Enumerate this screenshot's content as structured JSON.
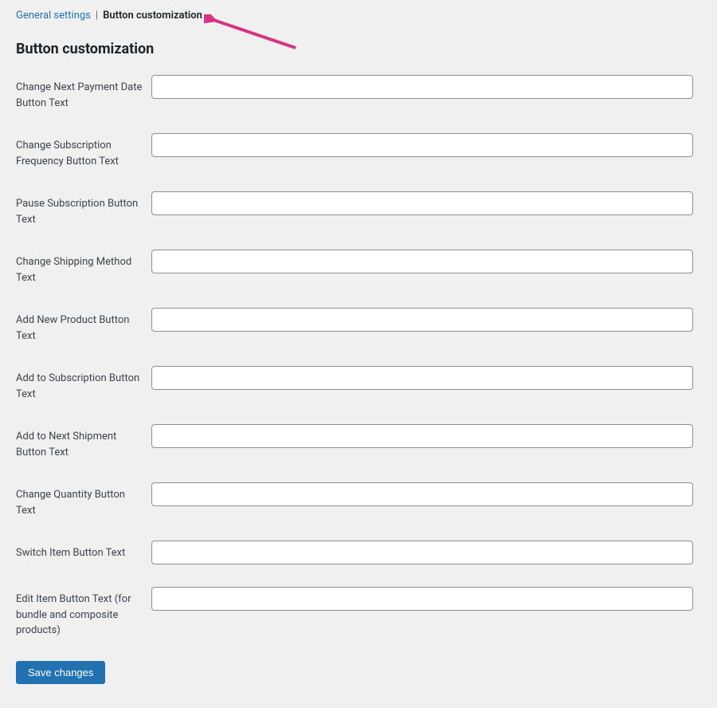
{
  "tabs": {
    "general": "General settings",
    "button_custom": "Button customization"
  },
  "section_title": "Button customization",
  "fields": [
    {
      "id": "change-next-payment-date",
      "label": "Change Next Payment Date Button Text",
      "value": ""
    },
    {
      "id": "change-subscription-frequency",
      "label": "Change Subscription Frequency Button Text",
      "value": ""
    },
    {
      "id": "pause-subscription",
      "label": "Pause Subscription Button Text",
      "value": ""
    },
    {
      "id": "change-shipping-method",
      "label": "Change Shipping Method Text",
      "value": ""
    },
    {
      "id": "add-new-product",
      "label": "Add New Product Button Text",
      "value": ""
    },
    {
      "id": "add-to-subscription",
      "label": "Add to Subscription Button Text",
      "value": ""
    },
    {
      "id": "add-to-next-shipment",
      "label": "Add to Next Shipment Button Text",
      "value": ""
    },
    {
      "id": "change-quantity",
      "label": "Change Quantity Button Text",
      "value": ""
    },
    {
      "id": "switch-item",
      "label": "Switch Item Button Text",
      "value": ""
    },
    {
      "id": "edit-item",
      "label": "Edit Item Button Text (for bundle and composite products)",
      "value": ""
    }
  ],
  "save_label": "Save changes"
}
